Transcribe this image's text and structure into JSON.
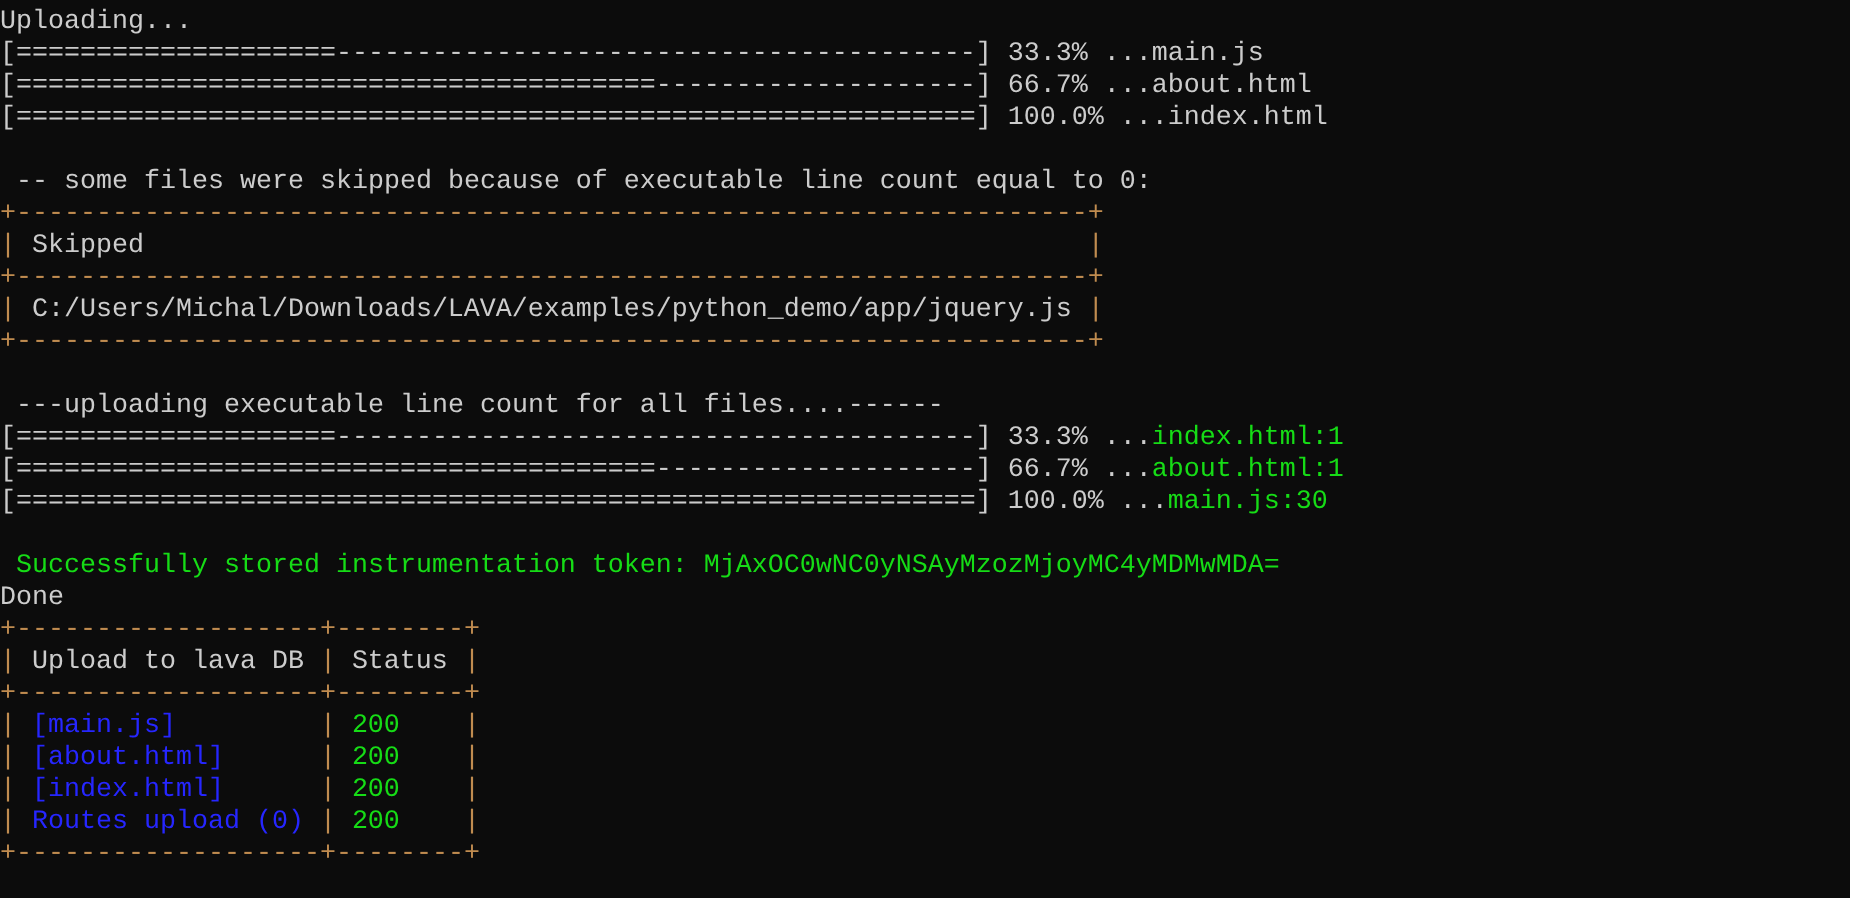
{
  "terminal": {
    "lines": [
      {
        "kind": "text",
        "segments": [
          {
            "text": "Uploading...",
            "kind": "plain"
          }
        ]
      },
      {
        "kind": "text",
        "segments": [
          {
            "text": "[====================----------------------------------------]",
            "kind": "bar"
          },
          {
            "text": " 33.3% ...",
            "kind": "plain"
          },
          {
            "text": "main.js",
            "kind": "plain"
          }
        ]
      },
      {
        "kind": "text",
        "segments": [
          {
            "text": "[========================================--------------------]",
            "kind": "bar"
          },
          {
            "text": " 66.7% ...",
            "kind": "plain"
          },
          {
            "text": "about.html",
            "kind": "plain"
          }
        ]
      },
      {
        "kind": "text",
        "segments": [
          {
            "text": "[============================================================]",
            "kind": "bar"
          },
          {
            "text": " 100.0% ...",
            "kind": "plain"
          },
          {
            "text": "index.html",
            "kind": "plain"
          }
        ]
      },
      {
        "kind": "blank"
      },
      {
        "kind": "text",
        "segments": [
          {
            "text": " -- some files were skipped because of executable line count equal to 0:",
            "kind": "plain"
          }
        ]
      },
      {
        "kind": "table",
        "rule": "+-------------------------------------------------------------------+",
        "separator": "|",
        "header": [
          {
            "text": "Skipped"
          }
        ],
        "rows": [
          [
            {
              "text": "C:/Users/Michal/Downloads/LAVA/examples/python_demo/app/jquery.js",
              "kind": "plain"
            }
          ]
        ]
      },
      {
        "kind": "blank"
      },
      {
        "kind": "text",
        "segments": [
          {
            "text": " ---uploading executable line count for all files....------",
            "kind": "plain"
          }
        ]
      },
      {
        "kind": "text",
        "segments": [
          {
            "text": "[====================----------------------------------------]",
            "kind": "bar"
          },
          {
            "text": " 33.3% ...",
            "kind": "plain"
          },
          {
            "text": "index.html:1",
            "kind": "success"
          }
        ]
      },
      {
        "kind": "text",
        "segments": [
          {
            "text": "[========================================--------------------]",
            "kind": "bar"
          },
          {
            "text": " 66.7% ...",
            "kind": "plain"
          },
          {
            "text": "about.html:1",
            "kind": "success"
          }
        ]
      },
      {
        "kind": "text",
        "segments": [
          {
            "text": "[============================================================]",
            "kind": "bar"
          },
          {
            "text": " 100.0% ...",
            "kind": "plain"
          },
          {
            "text": "main.js:30",
            "kind": "success"
          }
        ]
      },
      {
        "kind": "blank"
      },
      {
        "kind": "text",
        "segments": [
          {
            "text": " Successfully stored instrumentation token: MjAxOC0wNC0yNSAyMzozMjoyMC4yMDMwMDA=",
            "kind": "success"
          }
        ]
      },
      {
        "kind": "text",
        "segments": [
          {
            "text": "Done",
            "kind": "plain"
          }
        ]
      },
      {
        "kind": "table",
        "rule": "+-------------------+--------+",
        "separator": "|",
        "header": [
          {
            "text": "Upload to lava DB"
          },
          {
            "text": "Status"
          }
        ],
        "rows": [
          [
            {
              "text": "[main.js]",
              "kind": "link"
            },
            {
              "text": "200",
              "kind": "success"
            }
          ],
          [
            {
              "text": "[about.html]",
              "kind": "link"
            },
            {
              "text": "200",
              "kind": "success"
            }
          ],
          [
            {
              "text": "[index.html]",
              "kind": "link"
            },
            {
              "text": "200",
              "kind": "success"
            }
          ],
          [
            {
              "text": "Routes upload (0)",
              "kind": "link"
            },
            {
              "text": "200",
              "kind": "success"
            }
          ]
        ]
      }
    ]
  }
}
